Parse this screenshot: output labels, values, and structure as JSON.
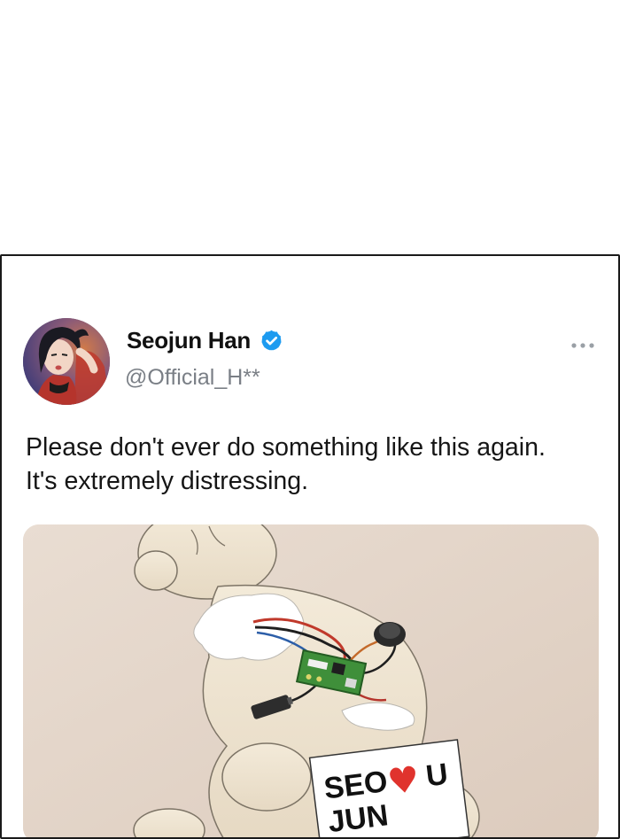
{
  "tweet": {
    "display_name": "Seojun Han",
    "verified": true,
    "handle": "@Official_H**",
    "text_lines": [
      "Please don't ever do something like this again.",
      "It's extremely distressing."
    ],
    "more_icon": "more-horizontal-icon",
    "verified_icon": "verified-badge-icon",
    "media": {
      "description_icon": "torn-teddy-bear-image",
      "sign_line1": "SEO",
      "sign_heart": "♥",
      "sign_line1_end": "U",
      "sign_line2": "JUN"
    }
  },
  "colors": {
    "verified_blue": "#1d9bf0",
    "card_border": "#1a1a1a",
    "handle_gray": "#7a7f86",
    "heart_red": "#e0332d",
    "media_bg": "#e6d8cc"
  }
}
